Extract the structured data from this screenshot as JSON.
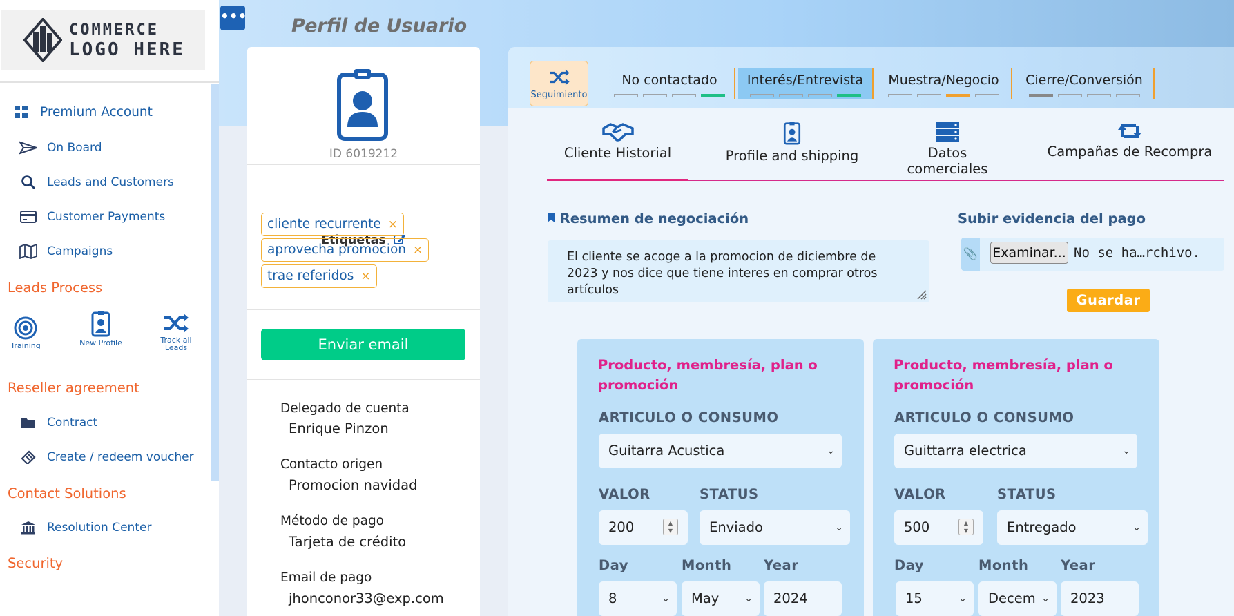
{
  "sidebar": {
    "logo": {
      "line1": "COMMERCE",
      "line2": "LOGO HERE"
    },
    "items": [
      {
        "label": "Premium Account",
        "icon": "grid-icon"
      },
      {
        "label": "On Board",
        "icon": "paper-plane-icon"
      },
      {
        "label": "Leads and Customers",
        "icon": "search-icon"
      },
      {
        "label": "Customer Payments",
        "icon": "credit-card-icon"
      },
      {
        "label": "Campaigns",
        "icon": "map-icon"
      }
    ],
    "sections": {
      "leads_process": "Leads Process",
      "reseller": "Reseller agreement",
      "contact": "Contact Solutions",
      "security": "Security"
    },
    "process": [
      {
        "label": "Training",
        "icon": "target-icon"
      },
      {
        "label": "New Profile",
        "icon": "id-badge-icon"
      },
      {
        "label": "Track all Leads",
        "icon": "shuffle-icon"
      }
    ],
    "reseller_items": [
      {
        "label": "Contract",
        "icon": "folder-icon"
      },
      {
        "label": "Create / redeem voucher",
        "icon": "ticket-icon"
      }
    ],
    "contact_items": [
      {
        "label": "Resolution Center",
        "icon": "bank-icon"
      }
    ]
  },
  "header": {
    "menu_glyph": "•••",
    "title": "Perfil de Usuario"
  },
  "profile": {
    "id": "ID 6019212",
    "tags_title": "Etiquetas",
    "tags": [
      "cliente recurrente",
      "aprovecha promocion",
      "trae referidos"
    ],
    "tag_remove": "×",
    "email_button": "Enviar email",
    "fields": [
      {
        "label": "Delegado de cuenta",
        "value": "Enrique Pinzon"
      },
      {
        "label": "Contacto origen",
        "value": "Promocion navidad"
      },
      {
        "label": "Método de pago",
        "value": "Tarjeta de crédito"
      },
      {
        "label": "Email de pago",
        "value": "jhonconor33@exp.com"
      }
    ]
  },
  "pipeline": {
    "seguimiento": "Seguimiento",
    "stages": [
      {
        "name": "No contactado",
        "progress": "4 of 4",
        "fill_color": "#1fbf86"
      },
      {
        "name": "Interés/Entrevista",
        "progress": "4 of 4",
        "fill_color": "#1fbf86"
      },
      {
        "name": "Muestra/Negocio",
        "progress": "3 of 4",
        "fill_color": "#f0a030"
      },
      {
        "name": "Cierre/Conversión",
        "progress": "1 of 4",
        "fill_color": "#888888"
      }
    ]
  },
  "tabs": [
    {
      "label": "Cliente Historial",
      "icon": "handshake-icon"
    },
    {
      "label": "Profile and shipping",
      "icon": "id-badge-icon"
    },
    {
      "label": "Datos comerciales",
      "icon": "server-icon"
    },
    {
      "label": "Campañas de Recompra",
      "icon": "retweet-icon"
    }
  ],
  "negotiation": {
    "title": "Resumen de negociación",
    "text": "El cliente se acoge a la promocion de diciembre de 2023 y nos dice que tiene interes en comprar otros artículos"
  },
  "upload": {
    "title": "Subir evidencia del pago",
    "browse": "Examinar...",
    "no_file": "No se ha…rchivo.",
    "save": "Guardar"
  },
  "products": [
    {
      "title": "Producto, membresía, plan o promoción",
      "article_label": "ARTICULO O CONSUMO",
      "article": "Guitarra Acustica",
      "valor_label": "VALOR",
      "valor": "200",
      "status_label": "STATUS",
      "status": "Enviado",
      "day_label": "Day",
      "day": "8",
      "month_label": "Month",
      "month": "May",
      "year_label": "Year",
      "year": "2024"
    },
    {
      "title": "Producto, membresía, plan o promoción",
      "article_label": "ARTICULO O CONSUMO",
      "article": "Guittarra electrica",
      "valor_label": "VALOR",
      "valor": "500",
      "status_label": "STATUS",
      "status": "Entregado",
      "day_label": "Day",
      "day": "15",
      "month_label": "Month",
      "month": "Decem",
      "year_label": "Year",
      "year": "2023"
    }
  ],
  "colors": {
    "accent": "#1b5fa7",
    "section": "#f0662e",
    "green": "#00cc88",
    "magenta": "#e0218a",
    "orange": "#fbac16"
  }
}
